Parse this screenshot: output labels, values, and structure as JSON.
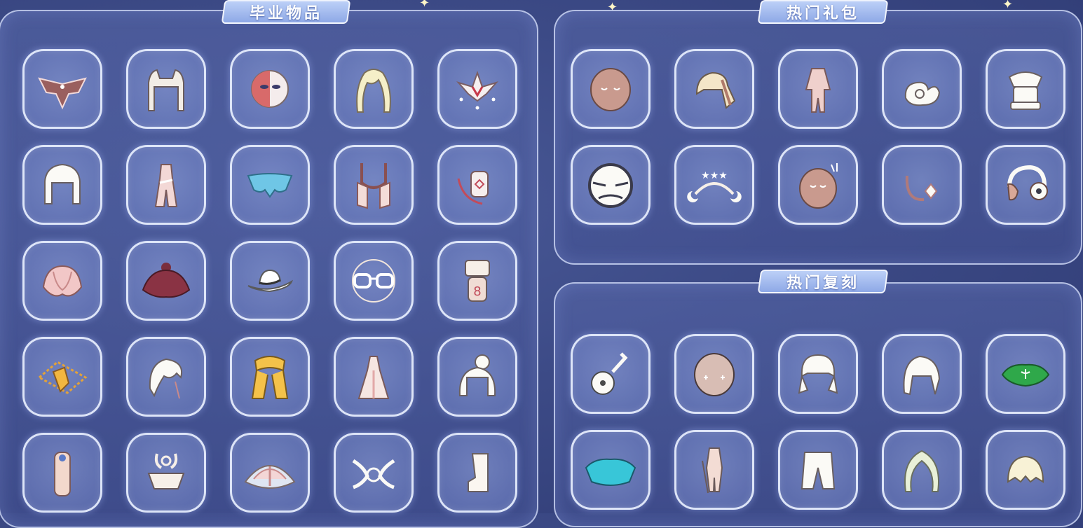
{
  "sections": {
    "graduation": {
      "title": "毕业物品"
    },
    "hot_gifts": {
      "title": "热门礼包"
    },
    "hot_rerun": {
      "title": "热门复刻"
    }
  },
  "graduation_items": [
    {
      "icon": "wing-cape-icon"
    },
    {
      "icon": "cat-ear-hair-icon"
    },
    {
      "icon": "half-mask-icon"
    },
    {
      "icon": "long-blonde-hair-icon"
    },
    {
      "icon": "lotus-headpiece-icon"
    },
    {
      "icon": "bob-hair-icon"
    },
    {
      "icon": "dress-outfit-icon"
    },
    {
      "icon": "butterfly-cape-icon"
    },
    {
      "icon": "scarf-cape-icon"
    },
    {
      "icon": "ornament-prop-icon"
    },
    {
      "icon": "shell-cape-icon"
    },
    {
      "icon": "red-cape-icon"
    },
    {
      "icon": "cowboy-hat-icon"
    },
    {
      "icon": "glasses-icon"
    },
    {
      "icon": "totem-prop-icon"
    },
    {
      "icon": "gold-amulet-icon"
    },
    {
      "icon": "feather-hair-icon"
    },
    {
      "icon": "gold-scarf-icon"
    },
    {
      "icon": "robe-outfit-icon"
    },
    {
      "icon": "bun-hair-icon"
    },
    {
      "icon": "scroll-prop-icon"
    },
    {
      "icon": "antler-mask-icon"
    },
    {
      "icon": "fan-cape-icon"
    },
    {
      "icon": "wing-mask-icon"
    },
    {
      "icon": "boot-icon"
    }
  ],
  "gift_items": [
    {
      "icon": "sleepy-mask-icon"
    },
    {
      "icon": "ponytail-hair-icon"
    },
    {
      "icon": "pink-outfit-icon"
    },
    {
      "icon": "snail-hair-icon"
    },
    {
      "icon": "puffy-outfit-icon"
    },
    {
      "icon": "cat-mask-icon"
    },
    {
      "icon": "moon-headband-icon"
    },
    {
      "icon": "antenna-mask-icon"
    },
    {
      "icon": "earring-icon"
    },
    {
      "icon": "headphones-icon"
    }
  ],
  "rerun_items": [
    {
      "icon": "guitar-icon"
    },
    {
      "icon": "blush-mask-icon"
    },
    {
      "icon": "pigtail-hair-icon"
    },
    {
      "icon": "twin-tail-hair-icon"
    },
    {
      "icon": "green-cape-icon"
    },
    {
      "icon": "cyan-cape-icon"
    },
    {
      "icon": "sword-outfit-icon"
    },
    {
      "icon": "pants-icon"
    },
    {
      "icon": "wavy-hair-icon"
    },
    {
      "icon": "short-hair-icon"
    }
  ],
  "colors": {
    "background": "#3c4a86",
    "panel_border": "#e6eeff",
    "tab_fill": "#a9bff2"
  }
}
